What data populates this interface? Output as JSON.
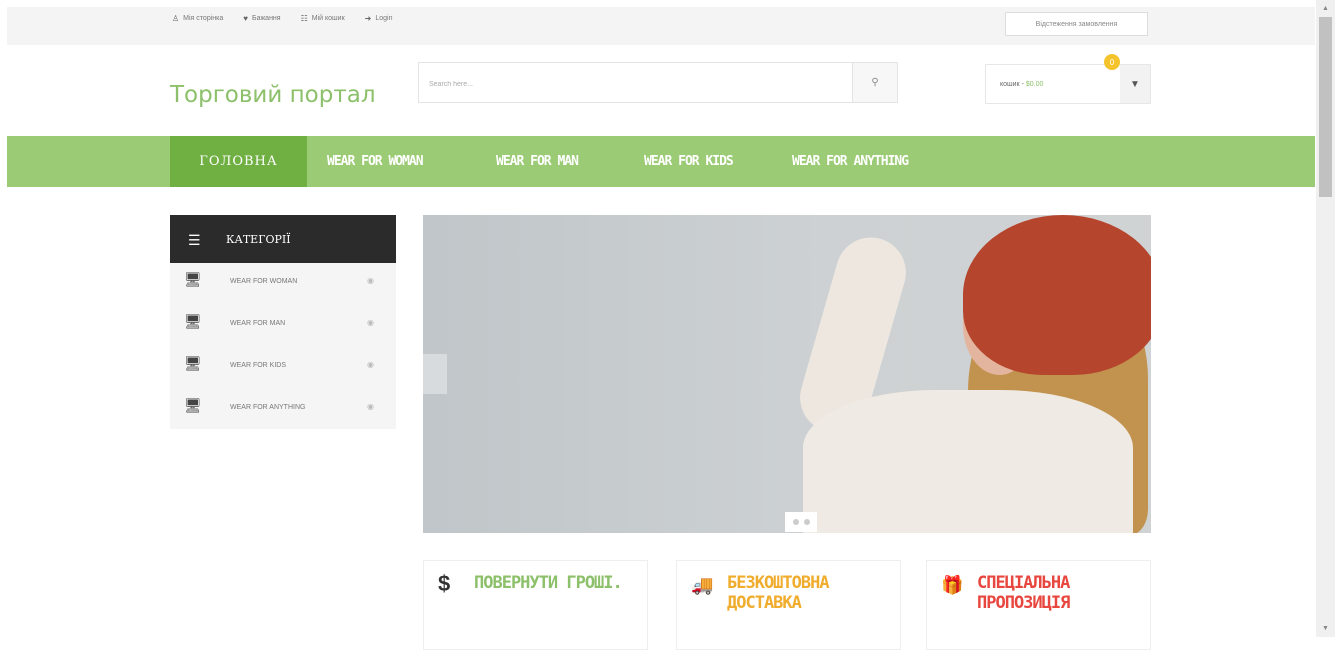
{
  "topbar": {
    "links": [
      {
        "label": "Мія сторінка",
        "icon": "user-icon"
      },
      {
        "label": "Бажання",
        "icon": "heart-icon"
      },
      {
        "label": "Мій кошик",
        "icon": "cart-icon"
      },
      {
        "label": "Login",
        "icon": "login-icon"
      }
    ],
    "order_button": "Відстеження замовлення"
  },
  "header": {
    "logo": "Торговий портал",
    "search_placeholder": "Search here...",
    "cart_label": "кошик -",
    "cart_price": "$0.00",
    "cart_count": "0"
  },
  "nav": {
    "items": [
      "ГОЛОВНА",
      "WEAR FOR WOMAN",
      "WEAR FOR MAN",
      "WEAR FOR KIDS",
      "WEAR FOR ANYTHING"
    ]
  },
  "sidebar": {
    "title": "КАТЕГОРІЇ",
    "items": [
      "WEAR FOR WOMAN",
      "WEAR FOR MAN",
      "WEAR FOR KIDS",
      "WEAR FOR ANYTHING"
    ]
  },
  "features": [
    {
      "icon": "dollar-icon",
      "glyph": "$",
      "title": "ПОВЕРНУТИ ГРОШІ.",
      "color": "#8dc06a"
    },
    {
      "icon": "truck-icon",
      "glyph": "🚚",
      "title": "БЕЗКОШТОВНА ДОСТАВКА",
      "color": "#f0ac2c"
    },
    {
      "icon": "gift-icon",
      "glyph": "🎁",
      "title": "СПЕЦІАЛЬНА ПРОПОЗИЦІЯ",
      "color": "#e8473f"
    }
  ],
  "colors": {
    "accent": "#9bcb74",
    "accent_dark": "#70b043",
    "logo": "#8dc06a"
  }
}
